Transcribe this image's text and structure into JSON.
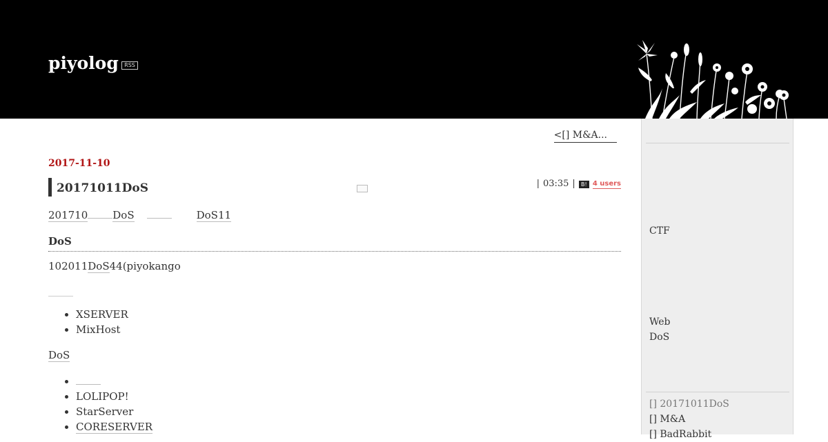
{
  "header": {
    "blog_title": "piyolog",
    "rss_label": "RSS"
  },
  "pager": {
    "prev_label": "<[] M&A..."
  },
  "entry": {
    "date": "2017-11-10",
    "title": "20171011DoS",
    "time": "03:35",
    "hatena_label": "B!",
    "bookmark_users": "4 users",
    "para1": {
      "t1": "201710",
      "t2": "DoS",
      "t3": "DoS11"
    },
    "heading": "DoS",
    "para2": {
      "t1": "102011",
      "t2": "DoS",
      "t3": "44(piyokango"
    },
    "list1": [
      "XSERVER",
      "MixHost"
    ],
    "para3": "DoS",
    "list2": [
      "",
      "LOLIPOP!",
      "StarServer",
      "CORESERVER"
    ]
  },
  "sidebar": {
    "text1": "CTF",
    "text2": "Web",
    "text3": "DoS",
    "recent": [
      "[] 20171011DoS",
      "[] M&A",
      "[] BadRabbit"
    ]
  }
}
